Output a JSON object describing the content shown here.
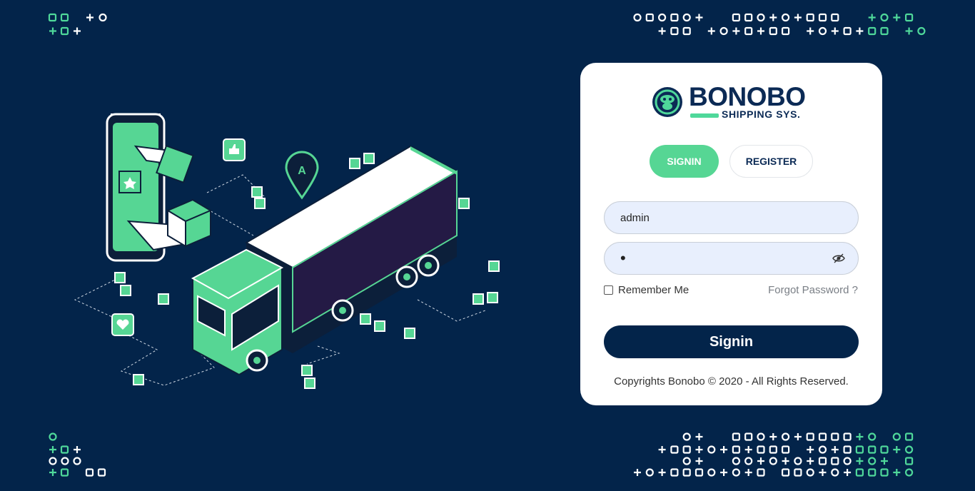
{
  "brand": {
    "name": "BONOBO",
    "subtitle": "SHIPPING SYS.",
    "logo_icon": "bonobo-face-icon",
    "primary_color": "#03244a",
    "accent_color": "#56d694"
  },
  "tabs": [
    {
      "label": "SIGNIN",
      "active": true
    },
    {
      "label": "REGISTER",
      "active": false
    }
  ],
  "form": {
    "username_value": "admin",
    "password_value": "•",
    "password_toggle_icon": "eye-slash-icon",
    "remember_label": "Remember Me",
    "remember_checked": false,
    "forgot_label": "Forgot Password ?",
    "submit_label": "Signin"
  },
  "footer": {
    "copyright": "Copyrights Bonobo © 2020 - All Rights Reserved."
  },
  "illustration": {
    "icon": "delivery-truck-illustration",
    "pin_letter": "A"
  }
}
